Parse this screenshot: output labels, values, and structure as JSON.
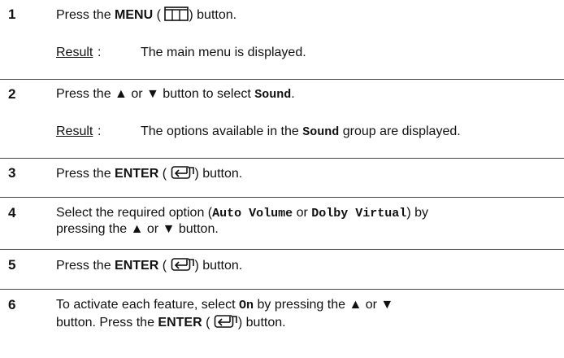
{
  "steps": [
    {
      "number": "1",
      "text": {
        "a": "Press the ",
        "b": "MENU",
        "c": " (",
        "d": ")  button."
      },
      "result_label": "Result",
      "result_colon": ":",
      "result_text": "The main menu is displayed."
    },
    {
      "number": "2",
      "text": {
        "a": "Press the ",
        "up": "▲",
        "or": " or ",
        "down": "▼",
        "b": " button to select ",
        "c": "Sound",
        "d": "."
      },
      "result_label": "Result",
      "result_colon": ":",
      "result_text": {
        "a": "The options available in the ",
        "b": "Sound",
        "c": " group are displayed."
      }
    },
    {
      "number": "3",
      "text": {
        "a": "Press the ",
        "b": "ENTER",
        "c": " (",
        "d": ") button."
      }
    },
    {
      "number": "4",
      "line1": {
        "a": "Select the required option (",
        "b": "Auto Volume",
        "c": " or ",
        "d": "Dolby Virtual",
        "e": ") by"
      },
      "line2": {
        "a": "pressing the ",
        "up": "▲",
        "or": " or ",
        "down": "▼",
        "b": " button."
      }
    },
    {
      "number": "5",
      "text": {
        "a": "Press the ",
        "b": "ENTER",
        "c": " (",
        "d": ") button."
      }
    },
    {
      "number": "6",
      "line1": {
        "a": "To activate each feature, select ",
        "b": "On",
        "c": " by pressing the ",
        "up": "▲",
        "or": " or ",
        "down": "▼"
      },
      "line2": {
        "a": "button. Press the ",
        "b": "ENTER",
        "c": " (",
        "d": ") button."
      }
    }
  ],
  "icons": {
    "menu": "menu-icon",
    "enter": "enter-icon"
  }
}
